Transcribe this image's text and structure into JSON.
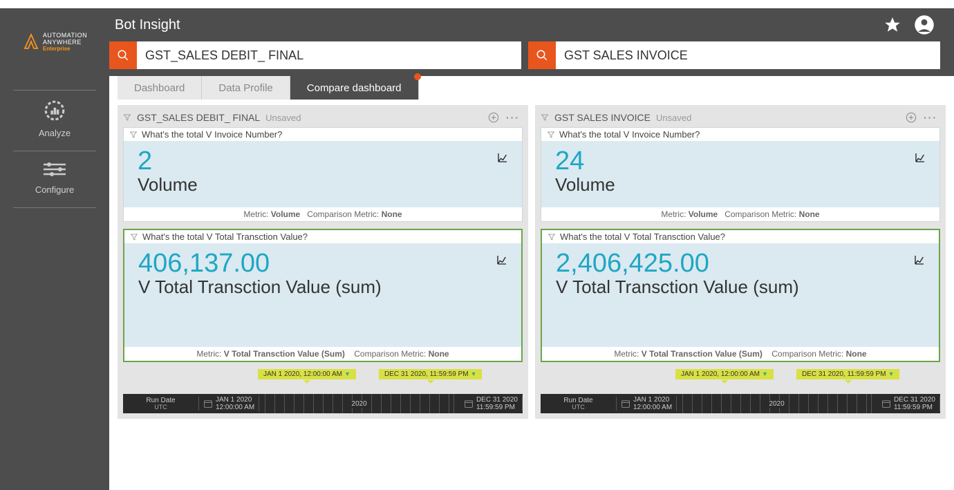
{
  "app": {
    "name_line1": "AUTOMATION",
    "name_line2": "ANYWHERE",
    "edition": "Enterprise",
    "title": "Bot Insight"
  },
  "search": {
    "left_value": "GST_SALES DEBIT_ FINAL",
    "right_value": "GST SALES INVOICE"
  },
  "sidebar": {
    "items": [
      {
        "label": "Analyze"
      },
      {
        "label": "Configure"
      }
    ]
  },
  "tabs": [
    {
      "label": "Dashboard",
      "active": false
    },
    {
      "label": "Data Profile",
      "active": false
    },
    {
      "label": "Compare dashboard",
      "active": true,
      "closable": true
    }
  ],
  "panels": [
    {
      "title": "GST_SALES DEBIT_ FINAL",
      "status": "Unsaved",
      "cards": [
        {
          "question": "What's the total V Invoice Number?",
          "value": "2",
          "label": "Volume",
          "metric": "Volume",
          "comparison": "None",
          "selected": false
        },
        {
          "question": "What's the total V Total Transction Value?",
          "value": "406,137.00",
          "label": "V Total Transction Value (sum)",
          "metric": "V Total Transction Value (Sum)",
          "comparison": "None",
          "selected": true
        }
      ],
      "timebar": {
        "rundate_label": "Run Date",
        "rundate_tz": "UTC",
        "start_date": "JAN 1 2020",
        "start_time": "12:00:00 AM",
        "end_date": "DEC 31 2020",
        "end_time": "11:59:59 PM",
        "axis_year": "2020",
        "tooltip_start": "JAN 1 2020, 12:00:00 AM",
        "tooltip_end": "DEC 31 2020, 11:59:59 PM"
      }
    },
    {
      "title": "GST SALES INVOICE",
      "status": "Unsaved",
      "cards": [
        {
          "question": "What's the total V Invoice Number?",
          "value": "24",
          "label": "Volume",
          "metric": "Volume",
          "comparison": "None",
          "selected": false
        },
        {
          "question": "What's the total V Total Transction Value?",
          "value": "2,406,425.00",
          "label": "V Total Transction Value (sum)",
          "metric": "V Total Transction Value (Sum)",
          "comparison": "None",
          "selected": true
        }
      ],
      "timebar": {
        "rundate_label": "Run Date",
        "rundate_tz": "UTC",
        "start_date": "JAN 1 2020",
        "start_time": "12:00:00 AM",
        "end_date": "DEC 31 2020",
        "end_time": "11:59:59 PM",
        "axis_year": "2020",
        "tooltip_start": "JAN 1 2020, 12:00:00 AM",
        "tooltip_end": "DEC 31 2020, 11:59:59 PM"
      }
    }
  ],
  "labels": {
    "metric": "Metric:",
    "comparison_metric": "Comparison Metric:"
  }
}
